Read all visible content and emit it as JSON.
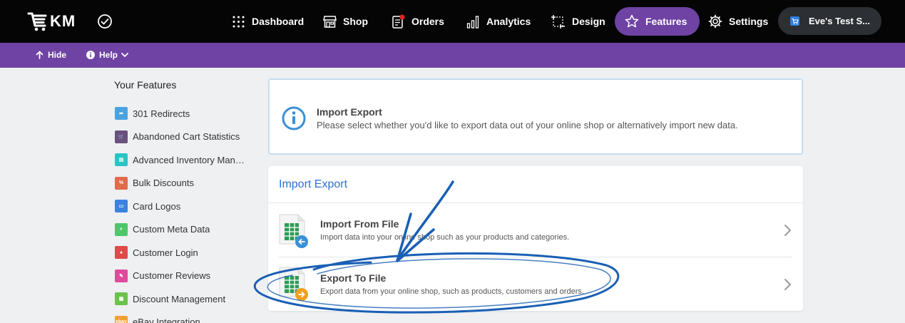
{
  "brand": {
    "logo_text": "KM"
  },
  "nav": {
    "items": [
      {
        "label": "Dashboard",
        "icon": "grid-dots-icon"
      },
      {
        "label": "Shop",
        "icon": "storefront-icon"
      },
      {
        "label": "Orders",
        "icon": "clipboard-icon"
      },
      {
        "label": "Analytics",
        "icon": "bar-chart-icon"
      },
      {
        "label": "Design",
        "icon": "design-frame-icon"
      },
      {
        "label": "Features",
        "icon": "star-icon"
      },
      {
        "label": "Settings",
        "icon": "gear-icon"
      }
    ],
    "active": "Features",
    "shop_name": "Eve's Test S..."
  },
  "subbar": {
    "hide_label": "Hide",
    "help_label": "Help"
  },
  "sidebar": {
    "title": "Your Features",
    "items": [
      {
        "label": "301 Redirects",
        "color": "#4aa3e0"
      },
      {
        "label": "Abandoned Cart Statistics",
        "color": "#6b4f7d"
      },
      {
        "label": "Advanced Inventory Management",
        "color": "#2bc4c4"
      },
      {
        "label": "Bulk Discounts",
        "color": "#e06a4a"
      },
      {
        "label": "Card Logos",
        "color": "#3b82e0"
      },
      {
        "label": "Custom Meta Data",
        "color": "#4cc76a"
      },
      {
        "label": "Customer Login",
        "color": "#e04a4a"
      },
      {
        "label": "Customer Reviews",
        "color": "#e04a9c"
      },
      {
        "label": "Discount Management",
        "color": "#6cc24a"
      },
      {
        "label": "eBay Integration",
        "color": "#f0a030",
        "badge": "ebay"
      }
    ]
  },
  "info": {
    "title": "Import Export",
    "description": "Please select whether you'd like to export data out of your online shop or alternatively import new data."
  },
  "card": {
    "title": "Import Export",
    "rows": [
      {
        "title": "Import From File",
        "description": "Import data into your online shop such as your products and categories.",
        "badge_color": "#3a8fd6"
      },
      {
        "title": "Export To File",
        "description": "Export data from your online shop, such as products, customers and orders.",
        "badge_color": "#f0a020"
      }
    ]
  },
  "colors": {
    "brand_purple": "#6e43a3",
    "link_blue": "#2f6fd3",
    "annotation_blue": "#1a5fb4"
  }
}
